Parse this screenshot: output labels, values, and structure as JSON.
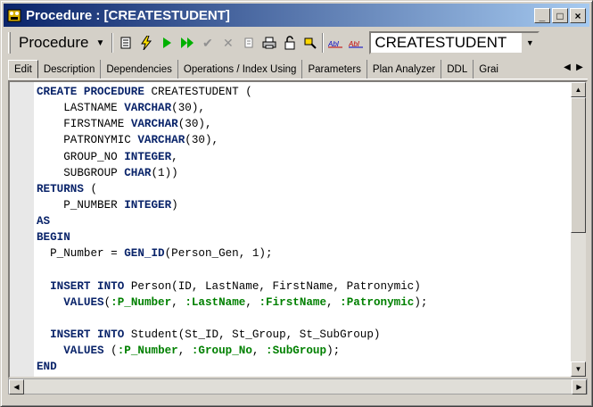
{
  "window": {
    "title": "Procedure : [CREATESTUDENT]",
    "buttons": {
      "minimize": "_",
      "maximize": "□",
      "close": "×"
    }
  },
  "toolbar": {
    "object_type_label": "Procedure",
    "object_selector_value": "CREATESTUDENT",
    "icons": [
      "properties-icon",
      "compile-icon",
      "run-icon",
      "run-all-icon",
      "commit-icon",
      "rollback-icon",
      "copy-icon",
      "print-icon",
      "lock-icon",
      "search-icon",
      "abc-icon",
      "def-icon"
    ]
  },
  "tabs": [
    {
      "label": "Edit",
      "active": true
    },
    {
      "label": "Description",
      "active": false
    },
    {
      "label": "Dependencies",
      "active": false
    },
    {
      "label": "Operations / Index Using",
      "active": false
    },
    {
      "label": "Parameters",
      "active": false
    },
    {
      "label": "Plan Analyzer",
      "active": false
    },
    {
      "label": "DDL",
      "active": false
    },
    {
      "label": "Grai",
      "active": false
    }
  ],
  "code_lines": [
    [
      [
        "kw",
        "CREATE PROCEDURE"
      ],
      [
        "t",
        " CREATESTUDENT ("
      ]
    ],
    [
      [
        "t",
        "    LASTNAME "
      ],
      [
        "kw",
        "VARCHAR"
      ],
      [
        "t",
        "(30),"
      ]
    ],
    [
      [
        "t",
        "    FIRSTNAME "
      ],
      [
        "kw",
        "VARCHAR"
      ],
      [
        "t",
        "(30),"
      ]
    ],
    [
      [
        "t",
        "    PATRONYMIC "
      ],
      [
        "kw",
        "VARCHAR"
      ],
      [
        "t",
        "(30),"
      ]
    ],
    [
      [
        "t",
        "    GROUP_NO "
      ],
      [
        "kw",
        "INTEGER"
      ],
      [
        "t",
        ","
      ]
    ],
    [
      [
        "t",
        "    SUBGROUP "
      ],
      [
        "kw",
        "CHAR"
      ],
      [
        "t",
        "(1))"
      ]
    ],
    [
      [
        "kw",
        "RETURNS"
      ],
      [
        "t",
        " ("
      ]
    ],
    [
      [
        "t",
        "    P_NUMBER "
      ],
      [
        "kw",
        "INTEGER"
      ],
      [
        "t",
        ")"
      ]
    ],
    [
      [
        "kw",
        "AS"
      ]
    ],
    [
      [
        "kw",
        "BEGIN"
      ]
    ],
    [
      [
        "t",
        "  P_Number = "
      ],
      [
        "kw",
        "GEN_ID"
      ],
      [
        "t",
        "(Person_Gen, 1);"
      ]
    ],
    [
      [
        "t",
        ""
      ]
    ],
    [
      [
        "t",
        "  "
      ],
      [
        "kw",
        "INSERT INTO"
      ],
      [
        "t",
        " Person(ID, LastName, FirstName, Patronymic)"
      ]
    ],
    [
      [
        "t",
        "    "
      ],
      [
        "kw",
        "VALUES"
      ],
      [
        "t",
        "("
      ],
      [
        "var",
        ":P_Number"
      ],
      [
        "t",
        ", "
      ],
      [
        "var",
        ":LastName"
      ],
      [
        "t",
        ", "
      ],
      [
        "var",
        ":FirstName"
      ],
      [
        "t",
        ", "
      ],
      [
        "var",
        ":Patronymic"
      ],
      [
        "t",
        ");"
      ]
    ],
    [
      [
        "t",
        ""
      ]
    ],
    [
      [
        "t",
        "  "
      ],
      [
        "kw",
        "INSERT INTO"
      ],
      [
        "t",
        " Student(St_ID, St_Group, St_SubGroup)"
      ]
    ],
    [
      [
        "t",
        "    "
      ],
      [
        "kw",
        "VALUES"
      ],
      [
        "t",
        " ("
      ],
      [
        "var",
        ":P_Number"
      ],
      [
        "t",
        ", "
      ],
      [
        "var",
        ":Group_No"
      ],
      [
        "t",
        ", "
      ],
      [
        "var",
        ":SubGroup"
      ],
      [
        "t",
        ");"
      ]
    ],
    [
      [
        "kw",
        "END"
      ]
    ]
  ],
  "colors": {
    "keyword": "#0a246a",
    "variable": "#008000",
    "titlebar_start": "#0a246a",
    "titlebar_end": "#a6caf0"
  }
}
